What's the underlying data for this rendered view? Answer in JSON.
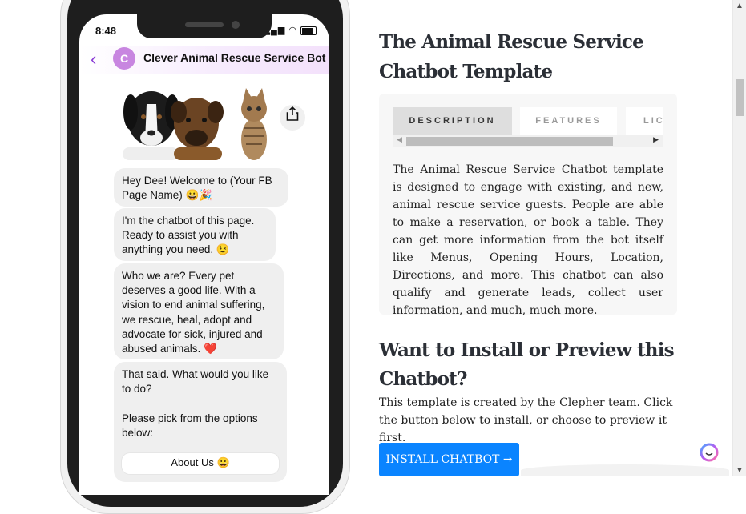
{
  "phone": {
    "status_time": "8:48",
    "bot_initial": "C",
    "bot_name": "Clever Animal Rescue Service Bot",
    "messages": [
      "Hey Dee! Welcome to (Your FB Page Name) 😀🎉",
      "I'm the chatbot of this page. Ready to assist you with anything you need. 😉",
      "Who we are? Every pet deserves a good life. With a vision to end animal suffering, we rescue, heal, adopt and advocate for sick, injured and abused animals. ❤️",
      "That said. What would you like to do?\n\nPlease pick from the options below:"
    ],
    "quick_reply": "About Us 😀"
  },
  "page": {
    "title": "The Animal Rescue Service Chatbot Template",
    "tabs": [
      "DESCRIPTION",
      "FEATURES",
      "LIC"
    ],
    "description": "The Animal Rescue Service Chatbot template is designed to engage with existing, and new, animal rescue service guests. People are able to make a reservation, or book a table. They can get more information from the bot itself like Menus, Opening Hours, Location, Directions, and more. This chatbot can also qualify and generate leads, collect user information, and much, much more.",
    "install_heading": "Want to Install or Preview this Chatbot?",
    "install_text": "This template is created by the Clepher team. Click the button below to install, or choose to preview it first.",
    "install_button": "INSTALL CHATBOT ➞"
  },
  "colors": {
    "accent": "#0a84ff",
    "bot_purple": "#8a3bd6"
  }
}
